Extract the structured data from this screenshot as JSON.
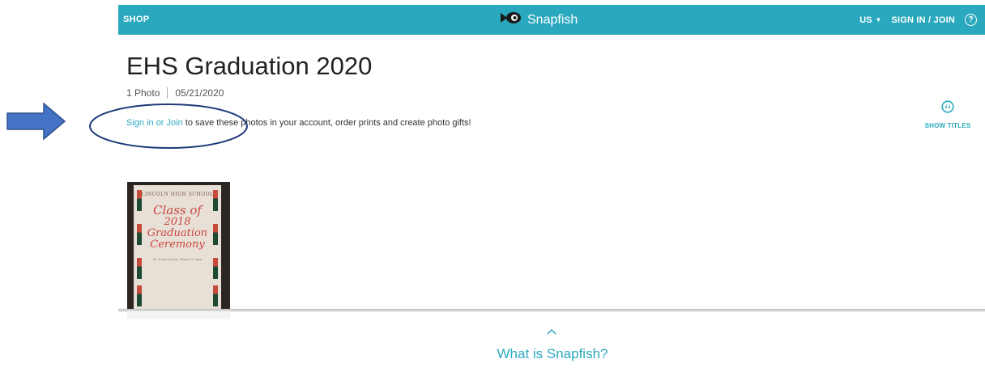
{
  "nav": {
    "shop_label": "SHOP",
    "brand_name": "Snapfish",
    "region_label": "US",
    "signin_label": "SIGN IN / JOIN",
    "help_symbol": "?"
  },
  "album": {
    "title": "EHS Graduation 2020",
    "photo_count": "1 Photo",
    "date": "05/21/2020"
  },
  "cta": {
    "link_text": "Sign in or Join",
    "rest_text": " to save these photos in your account, order prints and create photo gifts!"
  },
  "show_titles": {
    "label": "SHOW TITLES",
    "icon": "quote-bubble-icon"
  },
  "photo": {
    "school": "LINCOLN HIGH SCHOOL",
    "line1": "Class of",
    "line2": "2018",
    "line3": "Graduation",
    "line4": "Ceremony",
    "small": "St. Louis Arena, Room 3, 2pm"
  },
  "footer": {
    "what_label": "What is Snapfish?"
  },
  "colors": {
    "brand_teal": "#2aa8bd",
    "annotation_blue": "#4472c4",
    "circle_navy": "#1f3a7a"
  }
}
